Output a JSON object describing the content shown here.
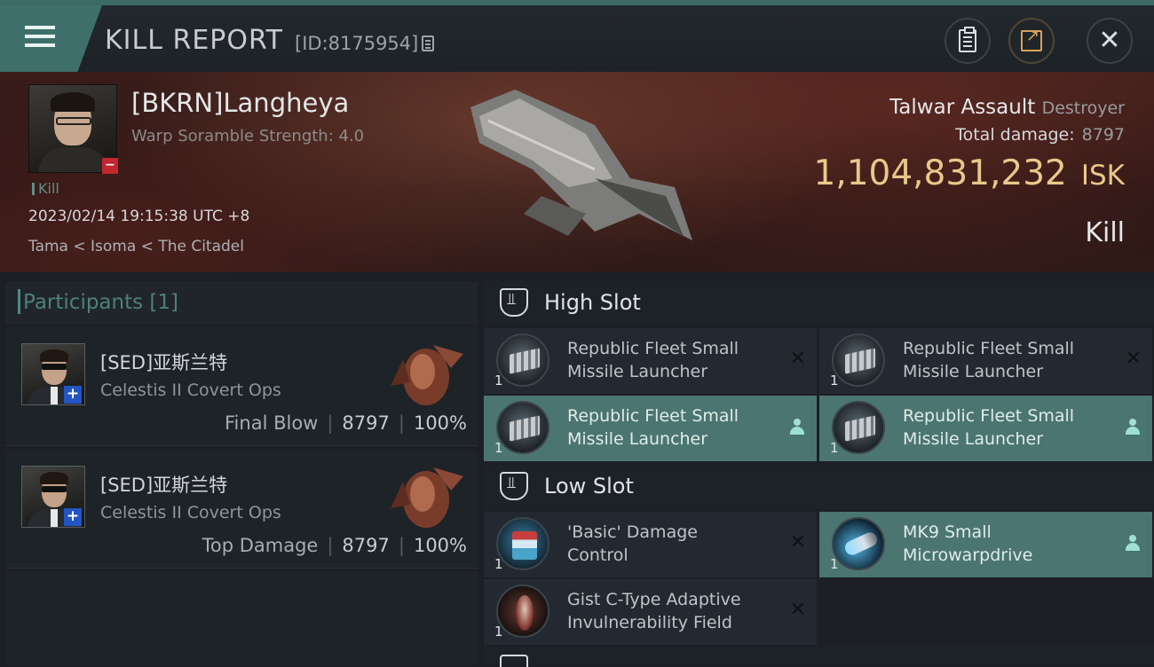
{
  "header": {
    "title": "KILL REPORT",
    "id_text": "[ID:8175954]"
  },
  "victim": {
    "name": "[BKRN]Langheya",
    "scramble": "Warp Soramble Strength: 4.0",
    "tag": "Kill",
    "datetime": "2023/02/14 19:15:38 UTC +8",
    "location": "Tama < Isoma < The Citadel",
    "ship": "Talwar Assault",
    "ship_class": "Destroyer",
    "total_damage_label": "Total damage:",
    "total_damage": "8797",
    "isk_value": "1,104,831,232",
    "isk_unit": "ISK",
    "result": "Kill"
  },
  "participants": {
    "title": "Participants [1]",
    "items": [
      {
        "name": "[SED]亚斯兰特",
        "ship": "Celestis II Covert Ops",
        "role": "Final Blow",
        "damage": "8797",
        "percent": "100%"
      },
      {
        "name": "[SED]亚斯兰特",
        "ship": "Celestis II Covert Ops",
        "role": "Top Damage",
        "damage": "8797",
        "percent": "100%"
      }
    ]
  },
  "slots": {
    "high": {
      "title": "High Slot",
      "items": [
        {
          "name_l1": "Republic Fleet Small",
          "name_l2": "Missile Launcher",
          "qty": "1",
          "state": "destroyed",
          "icon": "missile-launcher-icon"
        },
        {
          "name_l1": "Republic Fleet Small",
          "name_l2": "Missile Launcher",
          "qty": "1",
          "state": "destroyed",
          "icon": "missile-launcher-icon"
        },
        {
          "name_l1": "Republic Fleet Small",
          "name_l2": "Missile Launcher",
          "qty": "1",
          "state": "dropped",
          "icon": "missile-launcher-icon"
        },
        {
          "name_l1": "Republic Fleet Small",
          "name_l2": "Missile Launcher",
          "qty": "1",
          "state": "dropped",
          "icon": "missile-launcher-icon"
        }
      ]
    },
    "low": {
      "title": "Low Slot",
      "items": [
        {
          "name_l1": "'Basic' Damage",
          "name_l2": "Control",
          "qty": "1",
          "state": "destroyed",
          "icon": "damage-control-icon"
        },
        {
          "name_l1": "MK9 Small",
          "name_l2": "Microwarpdrive",
          "qty": "1",
          "state": "dropped",
          "icon": "microwarpdrive-icon"
        },
        {
          "name_l1": "Gist C-Type Adaptive",
          "name_l2": "Invulnerability Field",
          "qty": "1",
          "state": "destroyed",
          "icon": "invulnerability-field-icon"
        }
      ]
    }
  },
  "colors": {
    "accent": "#4b7570",
    "isk": "#e9c88a",
    "header_bar": "#3f6f6a"
  }
}
